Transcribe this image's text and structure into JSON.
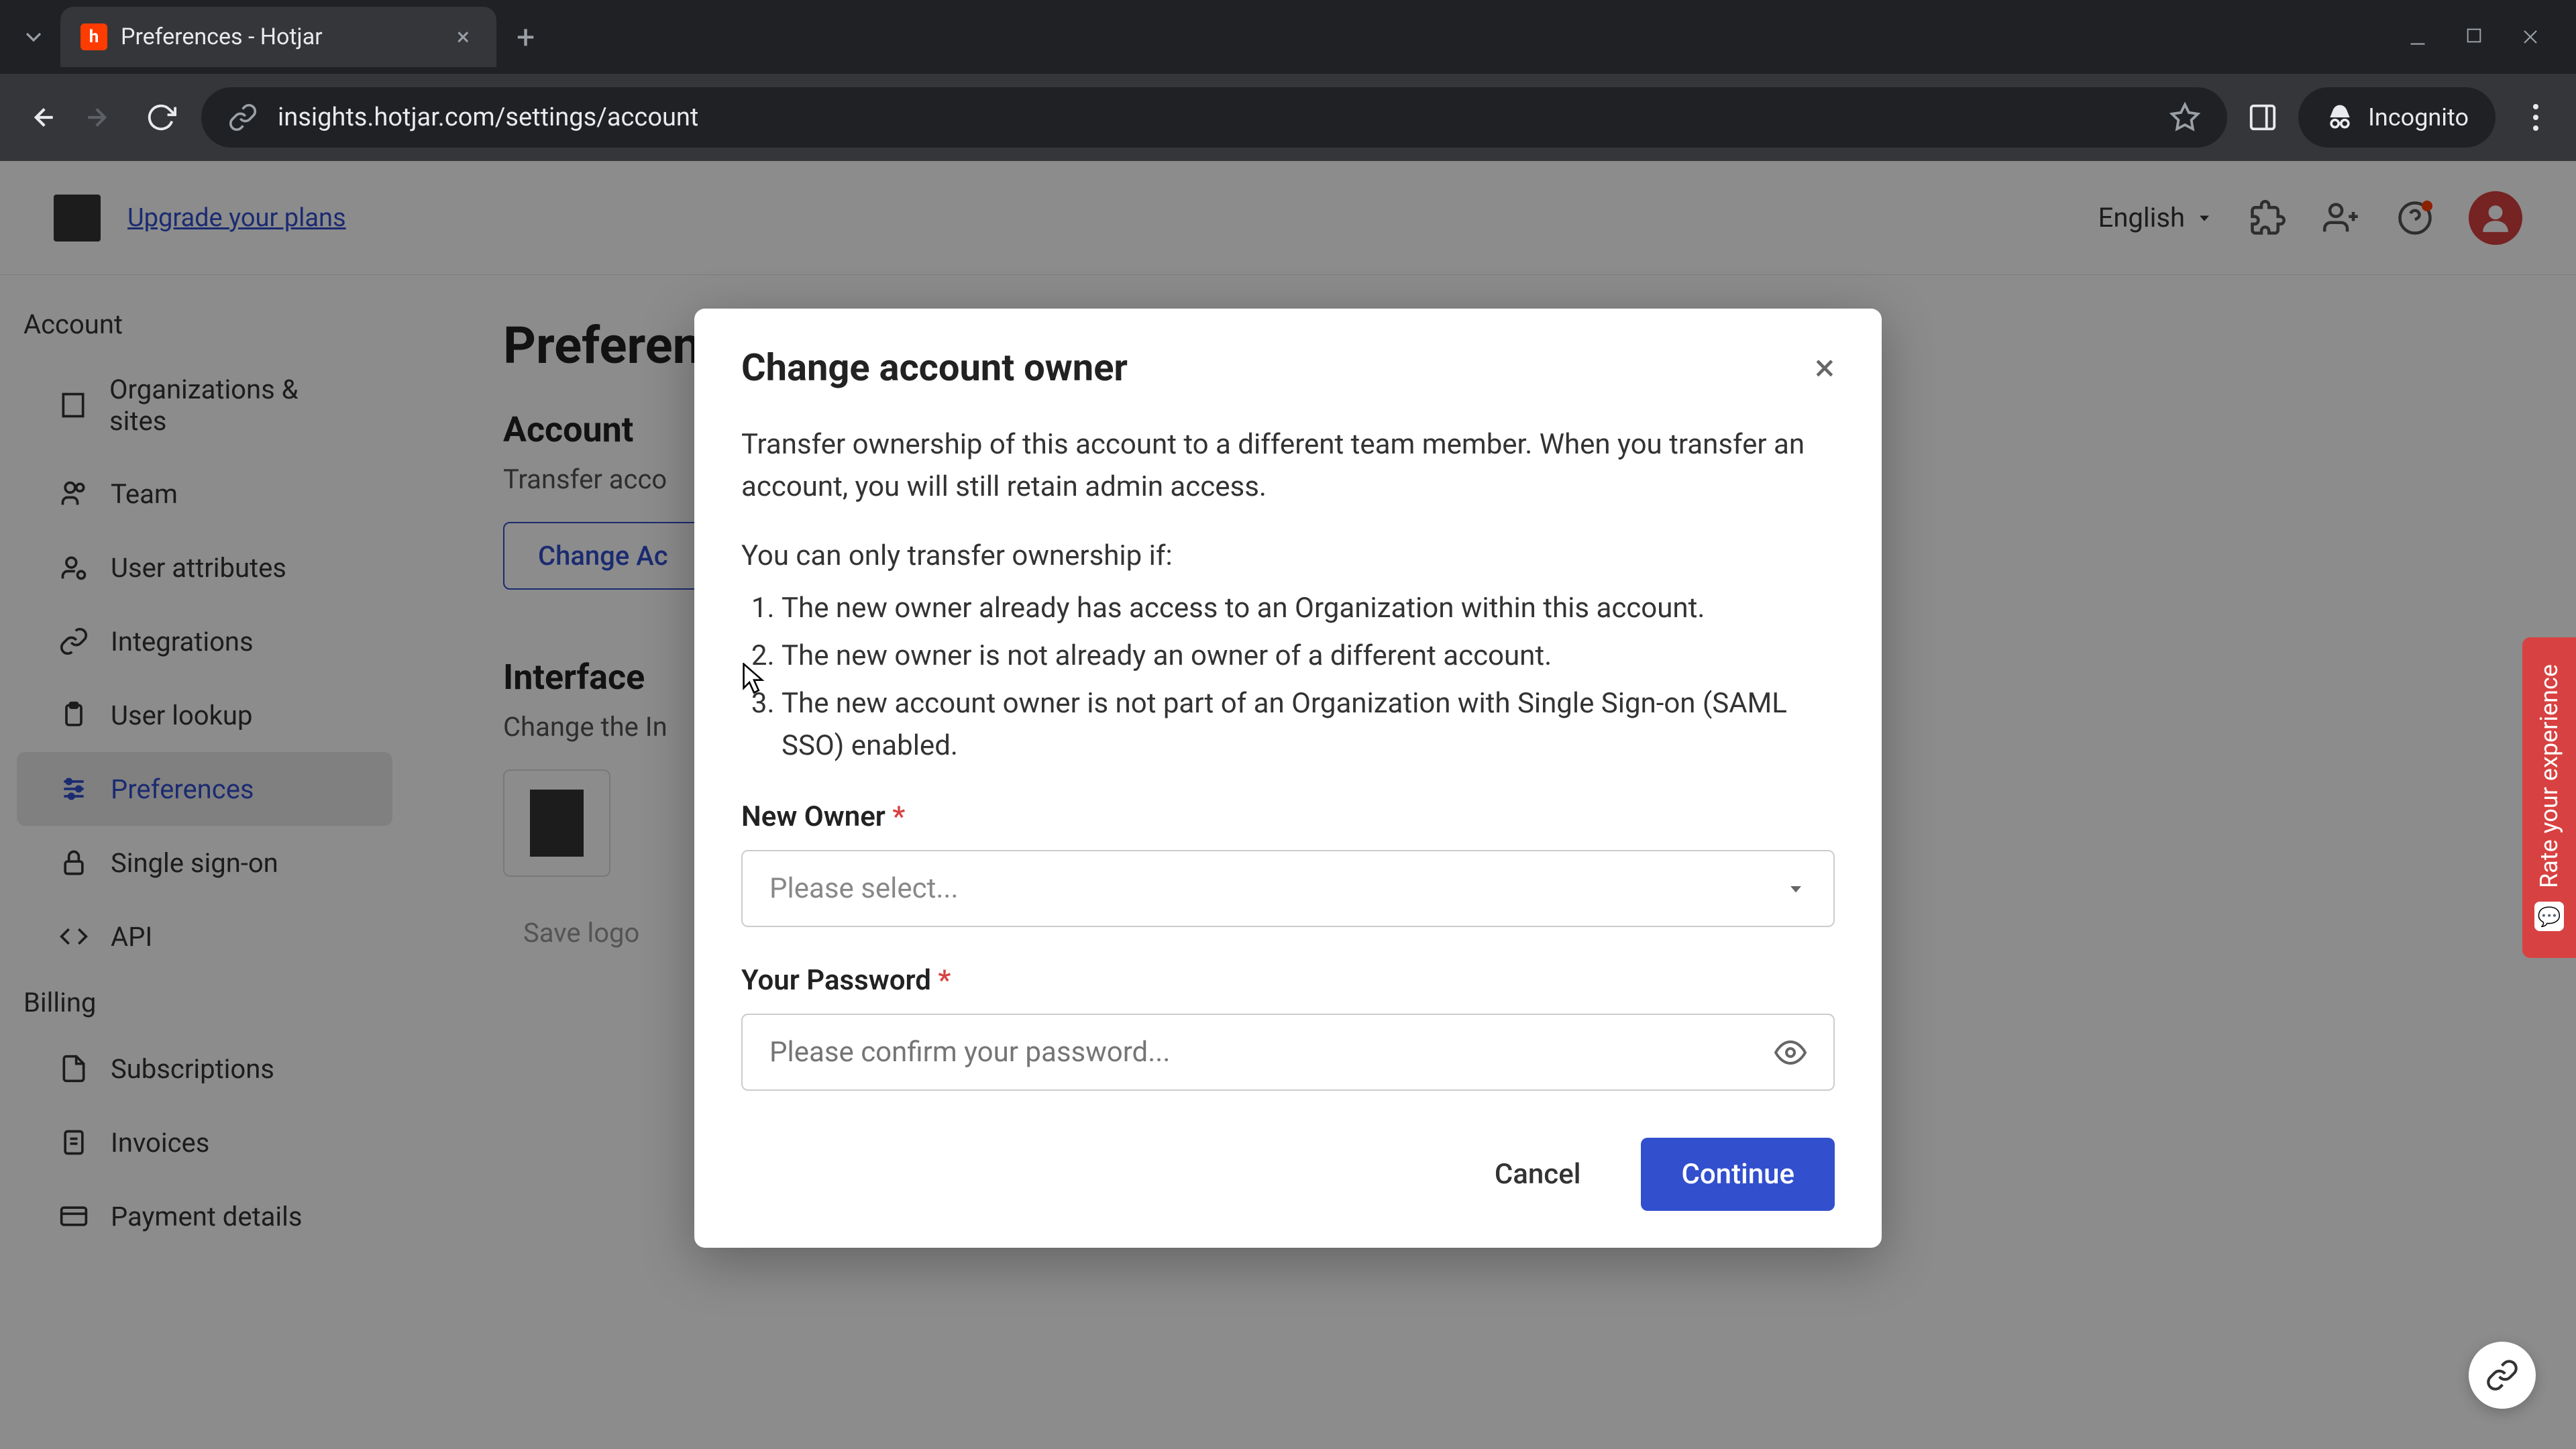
{
  "browser": {
    "tab_title": "Preferences - Hotjar",
    "url": "insights.hotjar.com/settings/account",
    "incognito_label": "Incognito"
  },
  "header": {
    "upgrade_link": "Upgrade your plans",
    "language": "English"
  },
  "sidebar": {
    "section_account": "Account",
    "section_billing": "Billing",
    "items": {
      "org_sites": "Organizations & sites",
      "team": "Team",
      "user_attributes": "User attributes",
      "integrations": "Integrations",
      "user_lookup": "User lookup",
      "preferences": "Preferences",
      "sso": "Single sign-on",
      "api": "API",
      "subscriptions": "Subscriptions",
      "invoices": "Invoices",
      "payment_details": "Payment details"
    }
  },
  "main": {
    "page_title": "Preferences",
    "account_section_title": "Account",
    "account_section_desc": "Transfer acco",
    "change_account_btn": "Change Ac",
    "interface_section_title": "Interface",
    "interface_section_desc": "Change the In",
    "save_logo_btn": "Save logo"
  },
  "modal": {
    "title": "Change account owner",
    "intro": "Transfer ownership of this account to a different team member. When you transfer an account, you will still retain admin access.",
    "conditions_intro": "You can only transfer ownership if:",
    "conditions": [
      "The new owner already has access to an Organization within this account.",
      "The new owner is not already an owner of a different account.",
      "The new account owner is not part of an Organization with Single Sign-on (SAML SSO) enabled."
    ],
    "new_owner_label": "New Owner",
    "new_owner_placeholder": "Please select...",
    "password_label": "Your Password",
    "password_placeholder": "Please confirm your password...",
    "cancel": "Cancel",
    "continue": "Continue"
  },
  "feedback_tab": "Rate your experience"
}
